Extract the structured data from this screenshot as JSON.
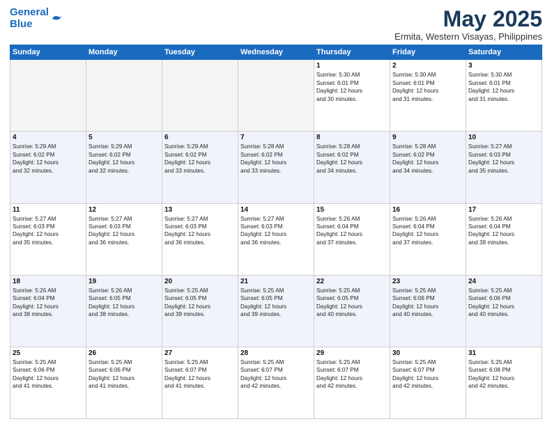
{
  "header": {
    "logo_line1": "General",
    "logo_line2": "Blue",
    "title": "May 2025",
    "location": "Ermita, Western Visayas, Philippines"
  },
  "days_of_week": [
    "Sunday",
    "Monday",
    "Tuesday",
    "Wednesday",
    "Thursday",
    "Friday",
    "Saturday"
  ],
  "weeks": [
    [
      {
        "day": "",
        "empty": true
      },
      {
        "day": "",
        "empty": true
      },
      {
        "day": "",
        "empty": true
      },
      {
        "day": "",
        "empty": true
      },
      {
        "day": "1",
        "info": "Sunrise: 5:30 AM\nSunset: 6:01 PM\nDaylight: 12 hours\nand 30 minutes."
      },
      {
        "day": "2",
        "info": "Sunrise: 5:30 AM\nSunset: 6:01 PM\nDaylight: 12 hours\nand 31 minutes."
      },
      {
        "day": "3",
        "info": "Sunrise: 5:30 AM\nSunset: 6:01 PM\nDaylight: 12 hours\nand 31 minutes."
      }
    ],
    [
      {
        "day": "4",
        "info": "Sunrise: 5:29 AM\nSunset: 6:02 PM\nDaylight: 12 hours\nand 32 minutes."
      },
      {
        "day": "5",
        "info": "Sunrise: 5:29 AM\nSunset: 6:02 PM\nDaylight: 12 hours\nand 32 minutes."
      },
      {
        "day": "6",
        "info": "Sunrise: 5:29 AM\nSunset: 6:02 PM\nDaylight: 12 hours\nand 33 minutes."
      },
      {
        "day": "7",
        "info": "Sunrise: 5:28 AM\nSunset: 6:02 PM\nDaylight: 12 hours\nand 33 minutes."
      },
      {
        "day": "8",
        "info": "Sunrise: 5:28 AM\nSunset: 6:02 PM\nDaylight: 12 hours\nand 34 minutes."
      },
      {
        "day": "9",
        "info": "Sunrise: 5:28 AM\nSunset: 6:02 PM\nDaylight: 12 hours\nand 34 minutes."
      },
      {
        "day": "10",
        "info": "Sunrise: 5:27 AM\nSunset: 6:03 PM\nDaylight: 12 hours\nand 35 minutes."
      }
    ],
    [
      {
        "day": "11",
        "info": "Sunrise: 5:27 AM\nSunset: 6:03 PM\nDaylight: 12 hours\nand 35 minutes."
      },
      {
        "day": "12",
        "info": "Sunrise: 5:27 AM\nSunset: 6:03 PM\nDaylight: 12 hours\nand 36 minutes."
      },
      {
        "day": "13",
        "info": "Sunrise: 5:27 AM\nSunset: 6:03 PM\nDaylight: 12 hours\nand 36 minutes."
      },
      {
        "day": "14",
        "info": "Sunrise: 5:27 AM\nSunset: 6:03 PM\nDaylight: 12 hours\nand 36 minutes."
      },
      {
        "day": "15",
        "info": "Sunrise: 5:26 AM\nSunset: 6:04 PM\nDaylight: 12 hours\nand 37 minutes."
      },
      {
        "day": "16",
        "info": "Sunrise: 5:26 AM\nSunset: 6:04 PM\nDaylight: 12 hours\nand 37 minutes."
      },
      {
        "day": "17",
        "info": "Sunrise: 5:26 AM\nSunset: 6:04 PM\nDaylight: 12 hours\nand 38 minutes."
      }
    ],
    [
      {
        "day": "18",
        "info": "Sunrise: 5:26 AM\nSunset: 6:04 PM\nDaylight: 12 hours\nand 38 minutes."
      },
      {
        "day": "19",
        "info": "Sunrise: 5:26 AM\nSunset: 6:05 PM\nDaylight: 12 hours\nand 38 minutes."
      },
      {
        "day": "20",
        "info": "Sunrise: 5:25 AM\nSunset: 6:05 PM\nDaylight: 12 hours\nand 39 minutes."
      },
      {
        "day": "21",
        "info": "Sunrise: 5:25 AM\nSunset: 6:05 PM\nDaylight: 12 hours\nand 39 minutes."
      },
      {
        "day": "22",
        "info": "Sunrise: 5:25 AM\nSunset: 6:05 PM\nDaylight: 12 hours\nand 40 minutes."
      },
      {
        "day": "23",
        "info": "Sunrise: 5:25 AM\nSunset: 6:06 PM\nDaylight: 12 hours\nand 40 minutes."
      },
      {
        "day": "24",
        "info": "Sunrise: 5:25 AM\nSunset: 6:06 PM\nDaylight: 12 hours\nand 40 minutes."
      }
    ],
    [
      {
        "day": "25",
        "info": "Sunrise: 5:25 AM\nSunset: 6:06 PM\nDaylight: 12 hours\nand 41 minutes."
      },
      {
        "day": "26",
        "info": "Sunrise: 5:25 AM\nSunset: 6:06 PM\nDaylight: 12 hours\nand 41 minutes."
      },
      {
        "day": "27",
        "info": "Sunrise: 5:25 AM\nSunset: 6:07 PM\nDaylight: 12 hours\nand 41 minutes."
      },
      {
        "day": "28",
        "info": "Sunrise: 5:25 AM\nSunset: 6:07 PM\nDaylight: 12 hours\nand 42 minutes."
      },
      {
        "day": "29",
        "info": "Sunrise: 5:25 AM\nSunset: 6:07 PM\nDaylight: 12 hours\nand 42 minutes."
      },
      {
        "day": "30",
        "info": "Sunrise: 5:25 AM\nSunset: 6:07 PM\nDaylight: 12 hours\nand 42 minutes."
      },
      {
        "day": "31",
        "info": "Sunrise: 5:25 AM\nSunset: 6:08 PM\nDaylight: 12 hours\nand 42 minutes."
      }
    ]
  ]
}
